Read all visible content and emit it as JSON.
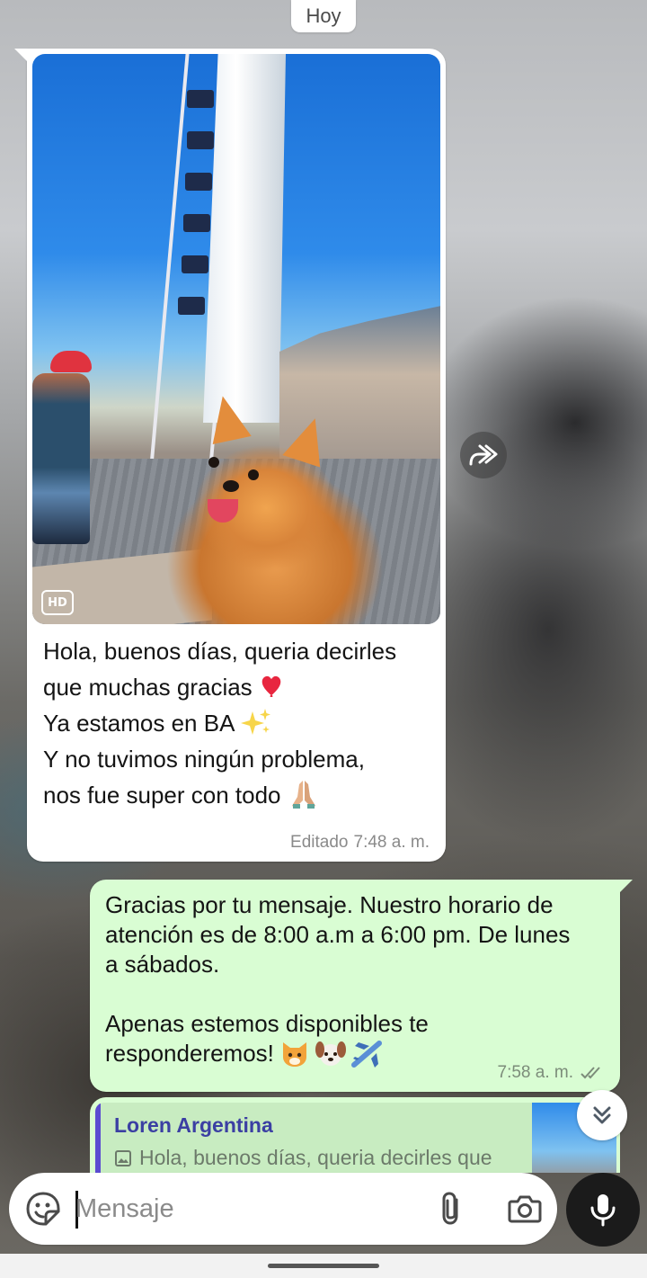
{
  "date_divider": "Hoy",
  "incoming": {
    "hd_label": "HD",
    "text_lines": [
      "Hola, buenos días, queria decirles",
      "que muchas gracias",
      "Ya estamos en BA",
      "Y no tuvimos ningún problema,",
      "nos fue super con todo"
    ],
    "emojis": [
      "heart",
      "sparkles",
      "folded-hands"
    ],
    "edited_label": "Editado",
    "time": "7:48 a. m."
  },
  "outgoing": {
    "text_lines": [
      "Gracias por tu mensaje. Nuestro horario de",
      "atención es de 8:00 a.m a 6:00 pm. De lunes",
      "a sábados.",
      "",
      "Apenas estemos disponibles te",
      "responderemos!"
    ],
    "emojis": [
      "cat",
      "dog",
      "airplane"
    ],
    "time": "7:58 a. m.",
    "status": "read"
  },
  "reply_preview": {
    "author": "Loren Argentina",
    "snippet": "Hola, buenos días, queria decirles que"
  },
  "composer": {
    "placeholder": "Mensaje"
  },
  "colors": {
    "outgoing_bubble": "#d9fdd3",
    "incoming_bubble": "#ffffff",
    "quote_bar": "#5b4bd1",
    "mic_button": "#1b1b1b"
  }
}
